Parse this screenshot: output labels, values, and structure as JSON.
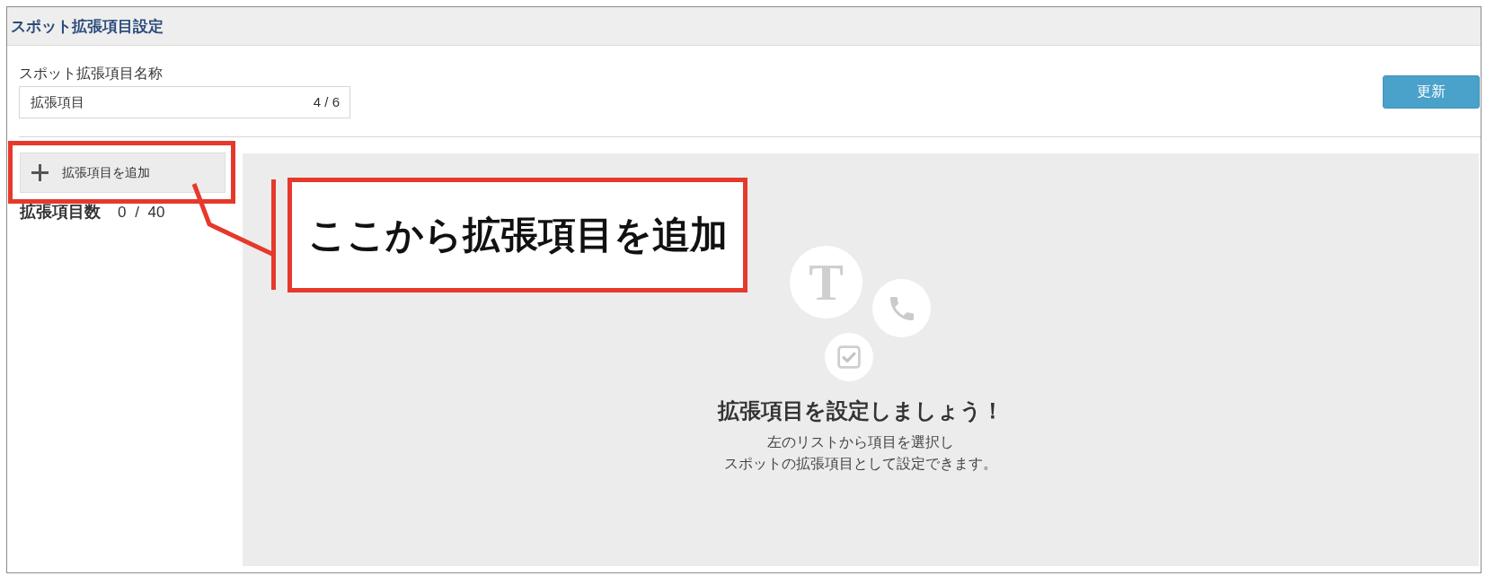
{
  "header": {
    "title": "スポット拡張項目設定"
  },
  "name_field": {
    "label": "スポット拡張項目名称",
    "value": "拡張項目",
    "counter": "4 / 6"
  },
  "update_button": {
    "label": "更新"
  },
  "sidebar": {
    "add_button": {
      "label": "拡張項目を追加"
    },
    "count": {
      "label": "拡張項目数",
      "value": "0 / 40"
    }
  },
  "empty_state": {
    "icons": [
      {
        "kind": "text",
        "glyph": "T"
      },
      {
        "kind": "phone"
      },
      {
        "kind": "checkbox"
      }
    ],
    "title": "拡張項目を設定しましょう！",
    "description_lines": [
      "左のリストから項目を選択し",
      "スポットの拡張項目として設定できます。"
    ]
  },
  "annotation": {
    "text": "ここから拡張項目を追加"
  }
}
